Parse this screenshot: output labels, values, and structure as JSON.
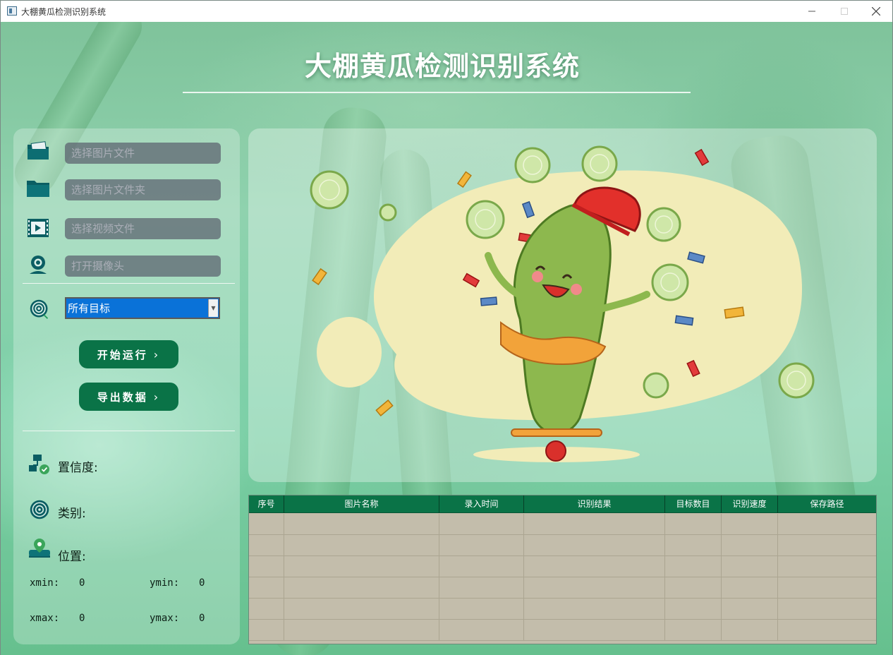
{
  "window": {
    "title": "大棚黄瓜检测识别系统",
    "controls": [
      "minimize",
      "maximize",
      "close"
    ]
  },
  "header": {
    "title": "大棚黄瓜检测识别系统"
  },
  "sidebar": {
    "inputs": [
      {
        "icon": "image-file-icon",
        "placeholder": "选择图片文件"
      },
      {
        "icon": "folder-icon",
        "placeholder": "选择图片文件夹"
      },
      {
        "icon": "video-file-icon",
        "placeholder": "选择视频文件"
      },
      {
        "icon": "camera-icon",
        "placeholder": "打开摄像头"
      }
    ],
    "target_select": {
      "icon": "target-icon",
      "selected": "所有目标"
    },
    "buttons": {
      "start": "开始运行",
      "export": "导出数据"
    },
    "info": {
      "confidence_label": "置信度:",
      "class_label": "类别:",
      "position_label": "位置:",
      "xmin_label": "xmin:",
      "xmin_value": "0",
      "ymin_label": "ymin:",
      "ymin_value": "0",
      "xmax_label": "xmax:",
      "xmax_value": "0",
      "ymax_label": "ymax:",
      "ymax_value": "0"
    }
  },
  "table": {
    "columns": [
      "序号",
      "图片名称",
      "录入时间",
      "识别结果",
      "目标数目",
      "识别速度",
      "保存路径"
    ],
    "rows": 6
  },
  "colors": {
    "accent_green": "#0a7347",
    "select_blue": "#0a72d8",
    "table_body": "#c3bdab"
  }
}
